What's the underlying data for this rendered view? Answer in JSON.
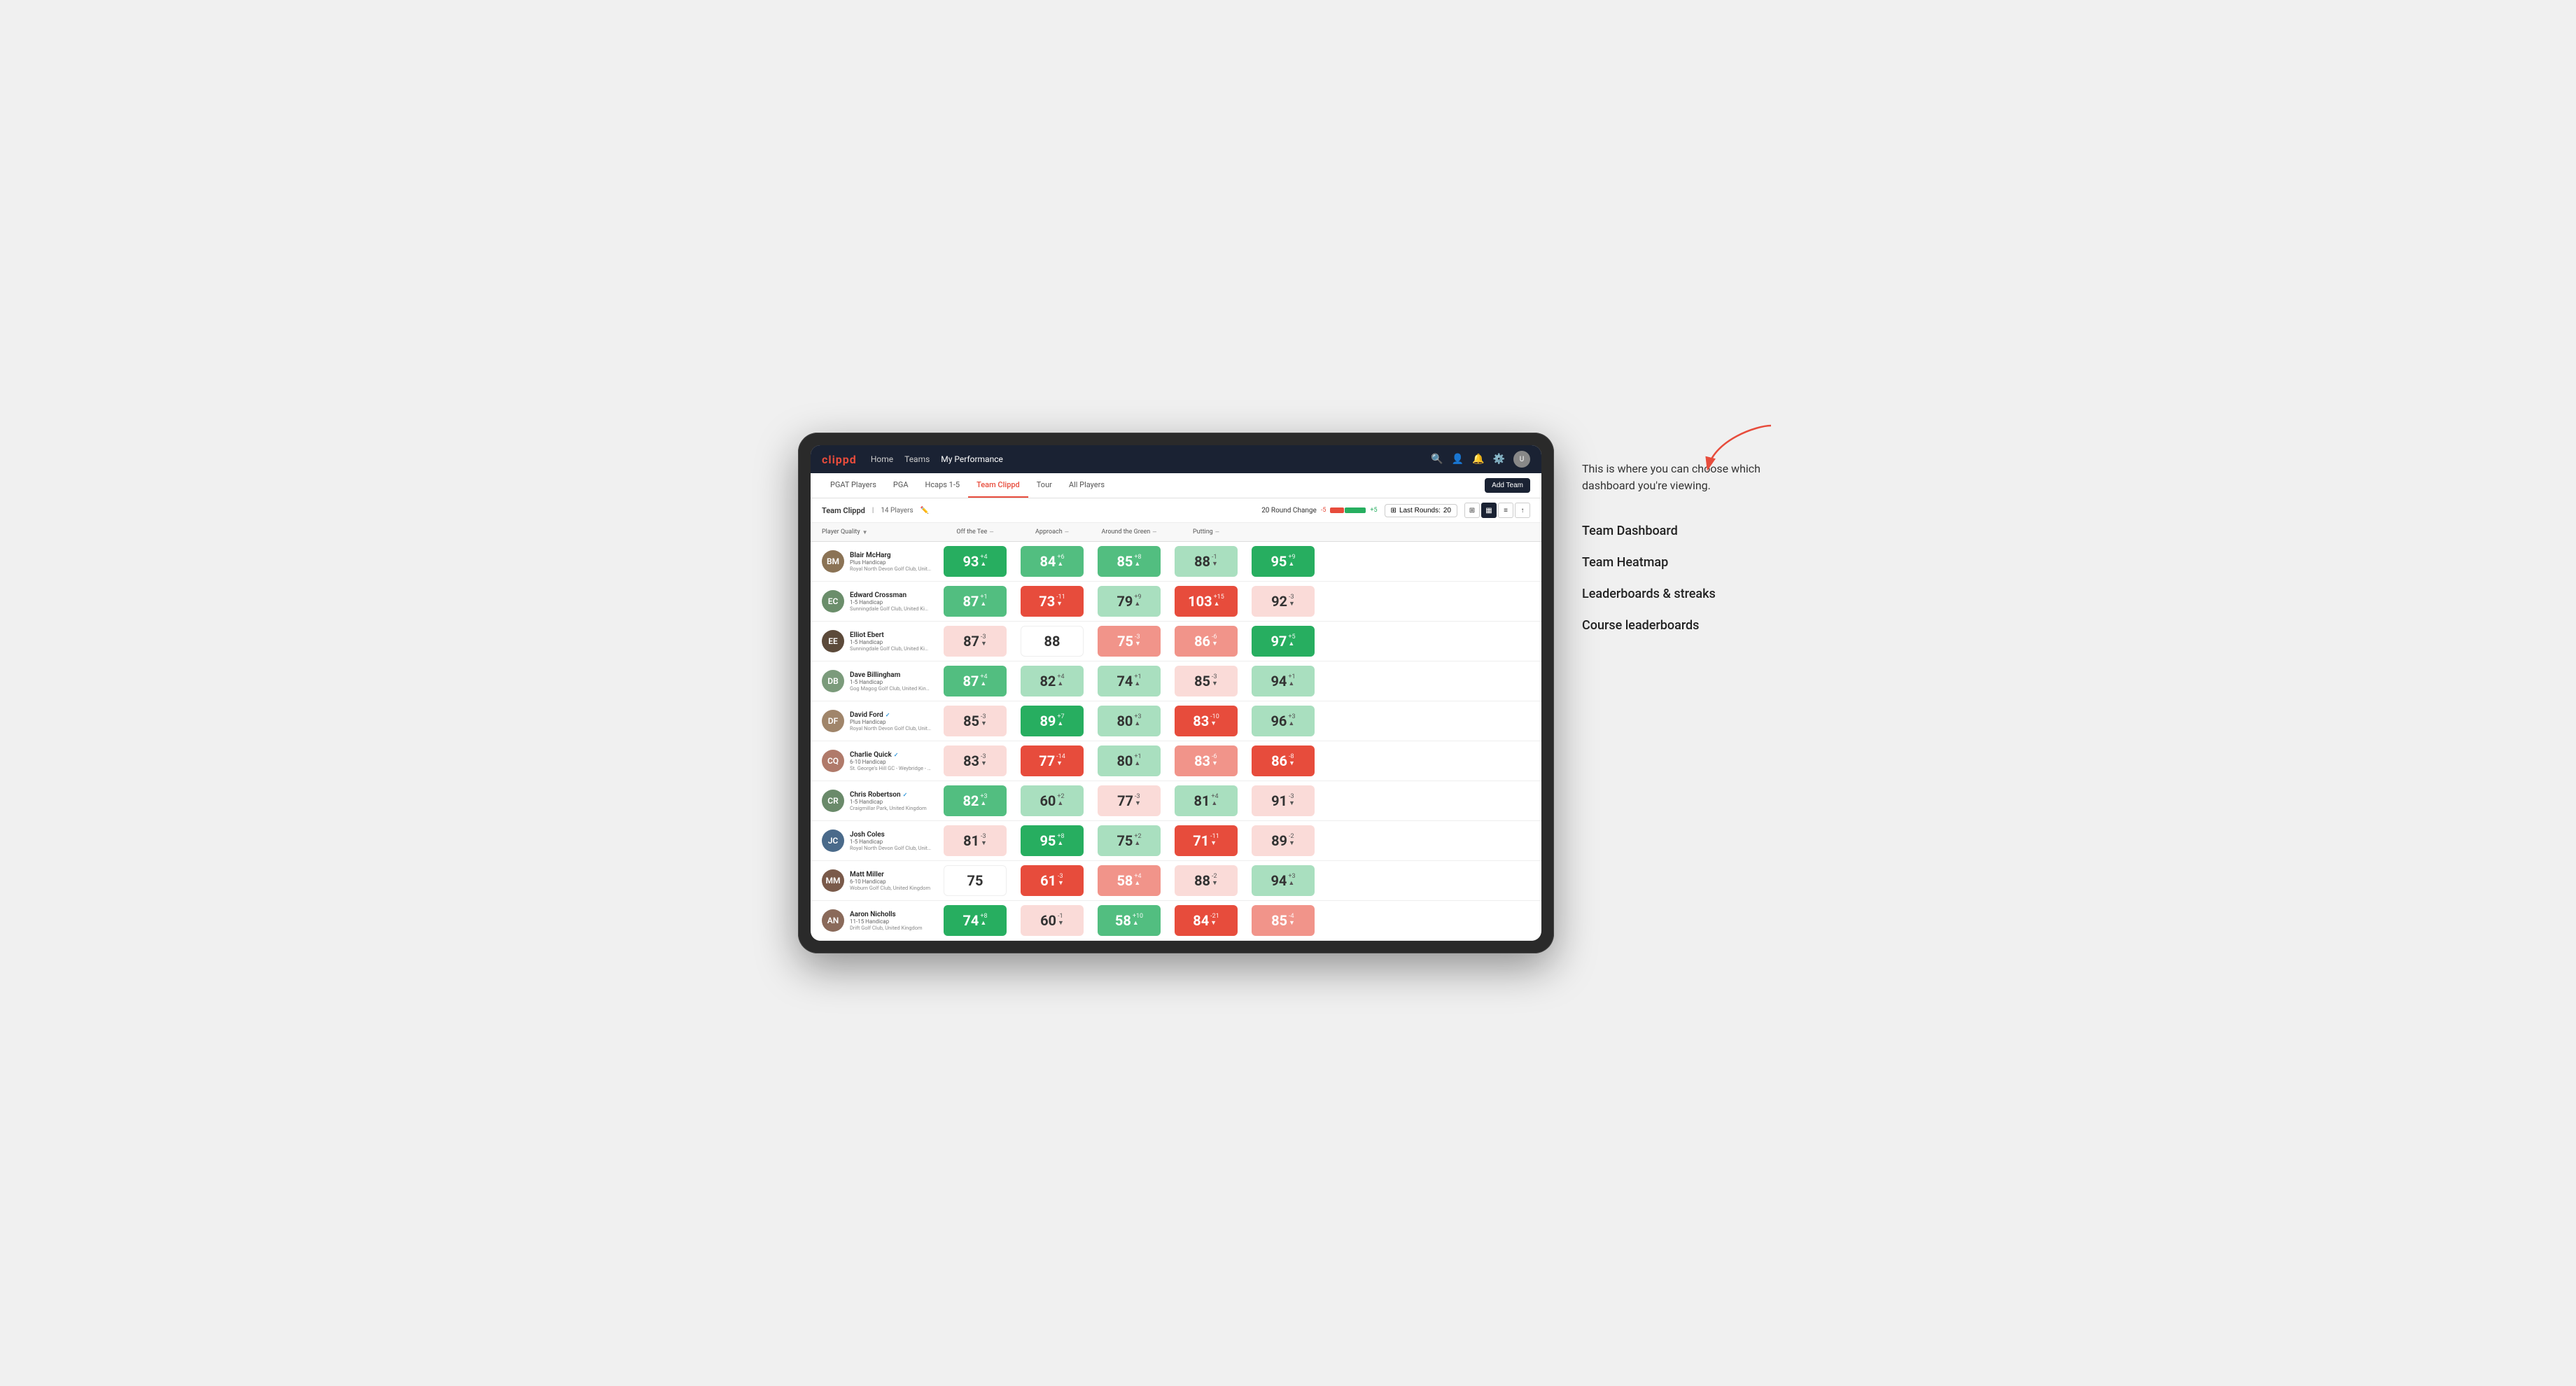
{
  "annotation": {
    "description": "This is where you can choose which dashboard you're viewing.",
    "options": [
      "Team Dashboard",
      "Team Heatmap",
      "Leaderboards & streaks",
      "Course leaderboards"
    ]
  },
  "nav": {
    "logo": "clippd",
    "links": [
      "Home",
      "Teams",
      "My Performance"
    ],
    "active_link": "My Performance"
  },
  "tabs": {
    "items": [
      "PGAT Players",
      "PGA",
      "Hcaps 1-5",
      "Team Clippd",
      "Tour",
      "All Players"
    ],
    "active": "Team Clippd",
    "add_button": "Add Team"
  },
  "team_bar": {
    "name": "Team Clippd",
    "count": "14 Players",
    "round_change_label": "20 Round Change",
    "change_neg": "-5",
    "change_pos": "+5",
    "last_rounds_label": "Last Rounds:",
    "last_rounds_value": "20"
  },
  "columns": {
    "player_quality": "Player Quality",
    "off_tee": "Off the Tee",
    "approach": "Approach",
    "around_green": "Around the Green",
    "putting": "Putting"
  },
  "players": [
    {
      "name": "Blair McHarg",
      "hcap": "Plus Handicap",
      "club": "Royal North Devon Golf Club, United Kingdom",
      "avatar_color": "#8B7355",
      "avatar_initials": "BM",
      "scores": {
        "quality": {
          "value": 93,
          "change": "+4",
          "dir": "up",
          "bg": "bg-green-dark"
        },
        "off_tee": {
          "value": 84,
          "change": "+6",
          "dir": "up",
          "bg": "bg-green-med"
        },
        "approach": {
          "value": 85,
          "change": "+8",
          "dir": "up",
          "bg": "bg-green-med"
        },
        "around_green": {
          "value": 88,
          "change": "-1",
          "dir": "down",
          "bg": "bg-green-light"
        },
        "putting": {
          "value": 95,
          "change": "+9",
          "dir": "up",
          "bg": "bg-green-dark"
        }
      }
    },
    {
      "name": "Edward Crossman",
      "hcap": "1-5 Handicap",
      "club": "Sunningdale Golf Club, United Kingdom",
      "avatar_color": "#6B8E6B",
      "avatar_initials": "EC",
      "scores": {
        "quality": {
          "value": 87,
          "change": "+1",
          "dir": "up",
          "bg": "bg-green-med"
        },
        "off_tee": {
          "value": 73,
          "change": "-11",
          "dir": "down",
          "bg": "bg-red-dark"
        },
        "approach": {
          "value": 79,
          "change": "+9",
          "dir": "up",
          "bg": "bg-green-light"
        },
        "around_green": {
          "value": 103,
          "change": "+15",
          "dir": "up",
          "bg": "bg-red-dark"
        },
        "putting": {
          "value": 92,
          "change": "-3",
          "dir": "down",
          "bg": "bg-red-light"
        }
      }
    },
    {
      "name": "Elliot Ebert",
      "hcap": "1-5 Handicap",
      "club": "Sunningdale Golf Club, United Kingdom",
      "avatar_color": "#5C4A3A",
      "avatar_initials": "EE",
      "scores": {
        "quality": {
          "value": 87,
          "change": "-3",
          "dir": "down",
          "bg": "bg-red-light"
        },
        "off_tee": {
          "value": 88,
          "change": "",
          "dir": "none",
          "bg": "bg-white"
        },
        "approach": {
          "value": 75,
          "change": "-3",
          "dir": "down",
          "bg": "bg-red-med"
        },
        "around_green": {
          "value": 86,
          "change": "-6",
          "dir": "down",
          "bg": "bg-red-med"
        },
        "putting": {
          "value": 97,
          "change": "+5",
          "dir": "up",
          "bg": "bg-green-dark"
        }
      }
    },
    {
      "name": "Dave Billingham",
      "hcap": "1-5 Handicap",
      "club": "Gog Magog Golf Club, United Kingdom",
      "avatar_color": "#7B9B7B",
      "avatar_initials": "DB",
      "scores": {
        "quality": {
          "value": 87,
          "change": "+4",
          "dir": "up",
          "bg": "bg-green-med"
        },
        "off_tee": {
          "value": 82,
          "change": "+4",
          "dir": "up",
          "bg": "bg-green-light"
        },
        "approach": {
          "value": 74,
          "change": "+1",
          "dir": "up",
          "bg": "bg-green-light"
        },
        "around_green": {
          "value": 85,
          "change": "-3",
          "dir": "down",
          "bg": "bg-red-light"
        },
        "putting": {
          "value": 94,
          "change": "+1",
          "dir": "up",
          "bg": "bg-green-light"
        }
      }
    },
    {
      "name": "David Ford",
      "hcap": "Plus Handicap",
      "club": "Royal North Devon Golf Club, United Kingdom",
      "avatar_color": "#A0856A",
      "avatar_initials": "DF",
      "verified": true,
      "scores": {
        "quality": {
          "value": 85,
          "change": "-3",
          "dir": "down",
          "bg": "bg-red-light"
        },
        "off_tee": {
          "value": 89,
          "change": "+7",
          "dir": "up",
          "bg": "bg-green-dark"
        },
        "approach": {
          "value": 80,
          "change": "+3",
          "dir": "up",
          "bg": "bg-green-light"
        },
        "around_green": {
          "value": 83,
          "change": "-10",
          "dir": "down",
          "bg": "bg-red-dark"
        },
        "putting": {
          "value": 96,
          "change": "+3",
          "dir": "up",
          "bg": "bg-green-light"
        }
      }
    },
    {
      "name": "Charlie Quick",
      "hcap": "6-10 Handicap",
      "club": "St. George's Hill GC - Weybridge - Surrey, Uni...",
      "avatar_color": "#B07A6A",
      "avatar_initials": "CQ",
      "verified": true,
      "scores": {
        "quality": {
          "value": 83,
          "change": "-3",
          "dir": "down",
          "bg": "bg-red-light"
        },
        "off_tee": {
          "value": 77,
          "change": "-14",
          "dir": "down",
          "bg": "bg-red-dark"
        },
        "approach": {
          "value": 80,
          "change": "+1",
          "dir": "up",
          "bg": "bg-green-light"
        },
        "around_green": {
          "value": 83,
          "change": "-6",
          "dir": "down",
          "bg": "bg-red-med"
        },
        "putting": {
          "value": 86,
          "change": "-8",
          "dir": "down",
          "bg": "bg-red-dark"
        }
      }
    },
    {
      "name": "Chris Robertson",
      "hcap": "1-5 Handicap",
      "club": "Craigmillar Park, United Kingdom",
      "avatar_color": "#6A8A6A",
      "avatar_initials": "CR",
      "verified": true,
      "scores": {
        "quality": {
          "value": 82,
          "change": "+3",
          "dir": "up",
          "bg": "bg-green-med"
        },
        "off_tee": {
          "value": 60,
          "change": "+2",
          "dir": "up",
          "bg": "bg-green-light"
        },
        "approach": {
          "value": 77,
          "change": "-3",
          "dir": "down",
          "bg": "bg-red-light"
        },
        "around_green": {
          "value": 81,
          "change": "+4",
          "dir": "up",
          "bg": "bg-green-light"
        },
        "putting": {
          "value": 91,
          "change": "-3",
          "dir": "down",
          "bg": "bg-red-light"
        }
      }
    },
    {
      "name": "Josh Coles",
      "hcap": "1-5 Handicap",
      "club": "Royal North Devon Golf Club, United Kingdom",
      "avatar_color": "#4A6A8A",
      "avatar_initials": "JC",
      "scores": {
        "quality": {
          "value": 81,
          "change": "-3",
          "dir": "down",
          "bg": "bg-red-light"
        },
        "off_tee": {
          "value": 95,
          "change": "+8",
          "dir": "up",
          "bg": "bg-green-dark"
        },
        "approach": {
          "value": 75,
          "change": "+2",
          "dir": "up",
          "bg": "bg-green-light"
        },
        "around_green": {
          "value": 71,
          "change": "-11",
          "dir": "down",
          "bg": "bg-red-dark"
        },
        "putting": {
          "value": 89,
          "change": "-2",
          "dir": "down",
          "bg": "bg-red-light"
        }
      }
    },
    {
      "name": "Matt Miller",
      "hcap": "6-10 Handicap",
      "club": "Woburn Golf Club, United Kingdom",
      "avatar_color": "#7A5A4A",
      "avatar_initials": "MM",
      "scores": {
        "quality": {
          "value": 75,
          "change": "",
          "dir": "none",
          "bg": "bg-white"
        },
        "off_tee": {
          "value": 61,
          "change": "-3",
          "dir": "down",
          "bg": "bg-red-dark"
        },
        "approach": {
          "value": 58,
          "change": "+4",
          "dir": "up",
          "bg": "bg-red-med"
        },
        "around_green": {
          "value": 88,
          "change": "-2",
          "dir": "down",
          "bg": "bg-red-light"
        },
        "putting": {
          "value": 94,
          "change": "+3",
          "dir": "up",
          "bg": "bg-green-light"
        }
      }
    },
    {
      "name": "Aaron Nicholls",
      "hcap": "11-15 Handicap",
      "club": "Drift Golf Club, United Kingdom",
      "avatar_color": "#8A6A5A",
      "avatar_initials": "AN",
      "scores": {
        "quality": {
          "value": 74,
          "change": "+8",
          "dir": "up",
          "bg": "bg-green-dark"
        },
        "off_tee": {
          "value": 60,
          "change": "-1",
          "dir": "down",
          "bg": "bg-red-light"
        },
        "approach": {
          "value": 58,
          "change": "+10",
          "dir": "up",
          "bg": "bg-green-med"
        },
        "around_green": {
          "value": 84,
          "change": "-21",
          "dir": "down",
          "bg": "bg-red-dark"
        },
        "putting": {
          "value": 85,
          "change": "-4",
          "dir": "down",
          "bg": "bg-red-med"
        }
      }
    }
  ]
}
